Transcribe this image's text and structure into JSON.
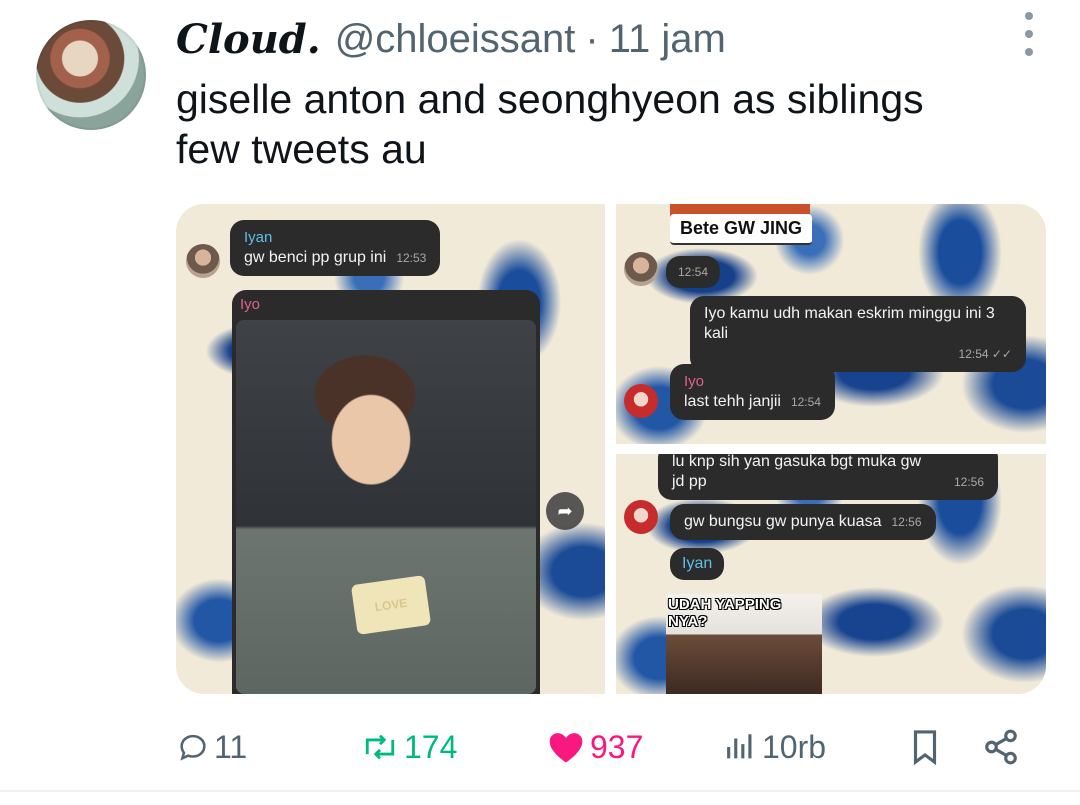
{
  "author": {
    "display_name": "Cloud.",
    "handle": "@chloeissant",
    "separator": "·",
    "time": "11 jam"
  },
  "tweet": {
    "text_line1": "giselle anton and seonghyeon as siblings",
    "text_line2": "few tweets au"
  },
  "media": {
    "left": {
      "msg1_name": "Iyan",
      "msg1_text": "gw benci pp grup ini",
      "msg1_time": "12:53",
      "msg2_name": "Iyo",
      "popsicle_text": "LOVE"
    },
    "top_right": {
      "sticker_text": "Bete GW JING",
      "time1": "12:54",
      "msg2_text": "Iyo kamu udh makan eskrim minggu ini 3 kali",
      "msg2_time": "12:54",
      "msg3_name": "Iyo",
      "msg3_text": "last tehh janjii",
      "msg3_time": "12:54"
    },
    "bottom_right": {
      "msg1_text_partial": "lu knp sih yan gasuka bgt muka gw",
      "msg1_text2": "jd pp",
      "msg1_time": "12:56",
      "msg2_text": "gw bungsu gw punya kuasa",
      "msg2_time": "12:56",
      "msg3_name": "Iyan",
      "meme_text": "UDAH YAPPING NYA?"
    }
  },
  "actions": {
    "replies": "11",
    "retweets": "174",
    "likes": "937",
    "views": "10rb"
  },
  "colors": {
    "text": "#0f1419",
    "muted": "#536471",
    "retweet": "#00ba7c",
    "like": "#f91880"
  }
}
